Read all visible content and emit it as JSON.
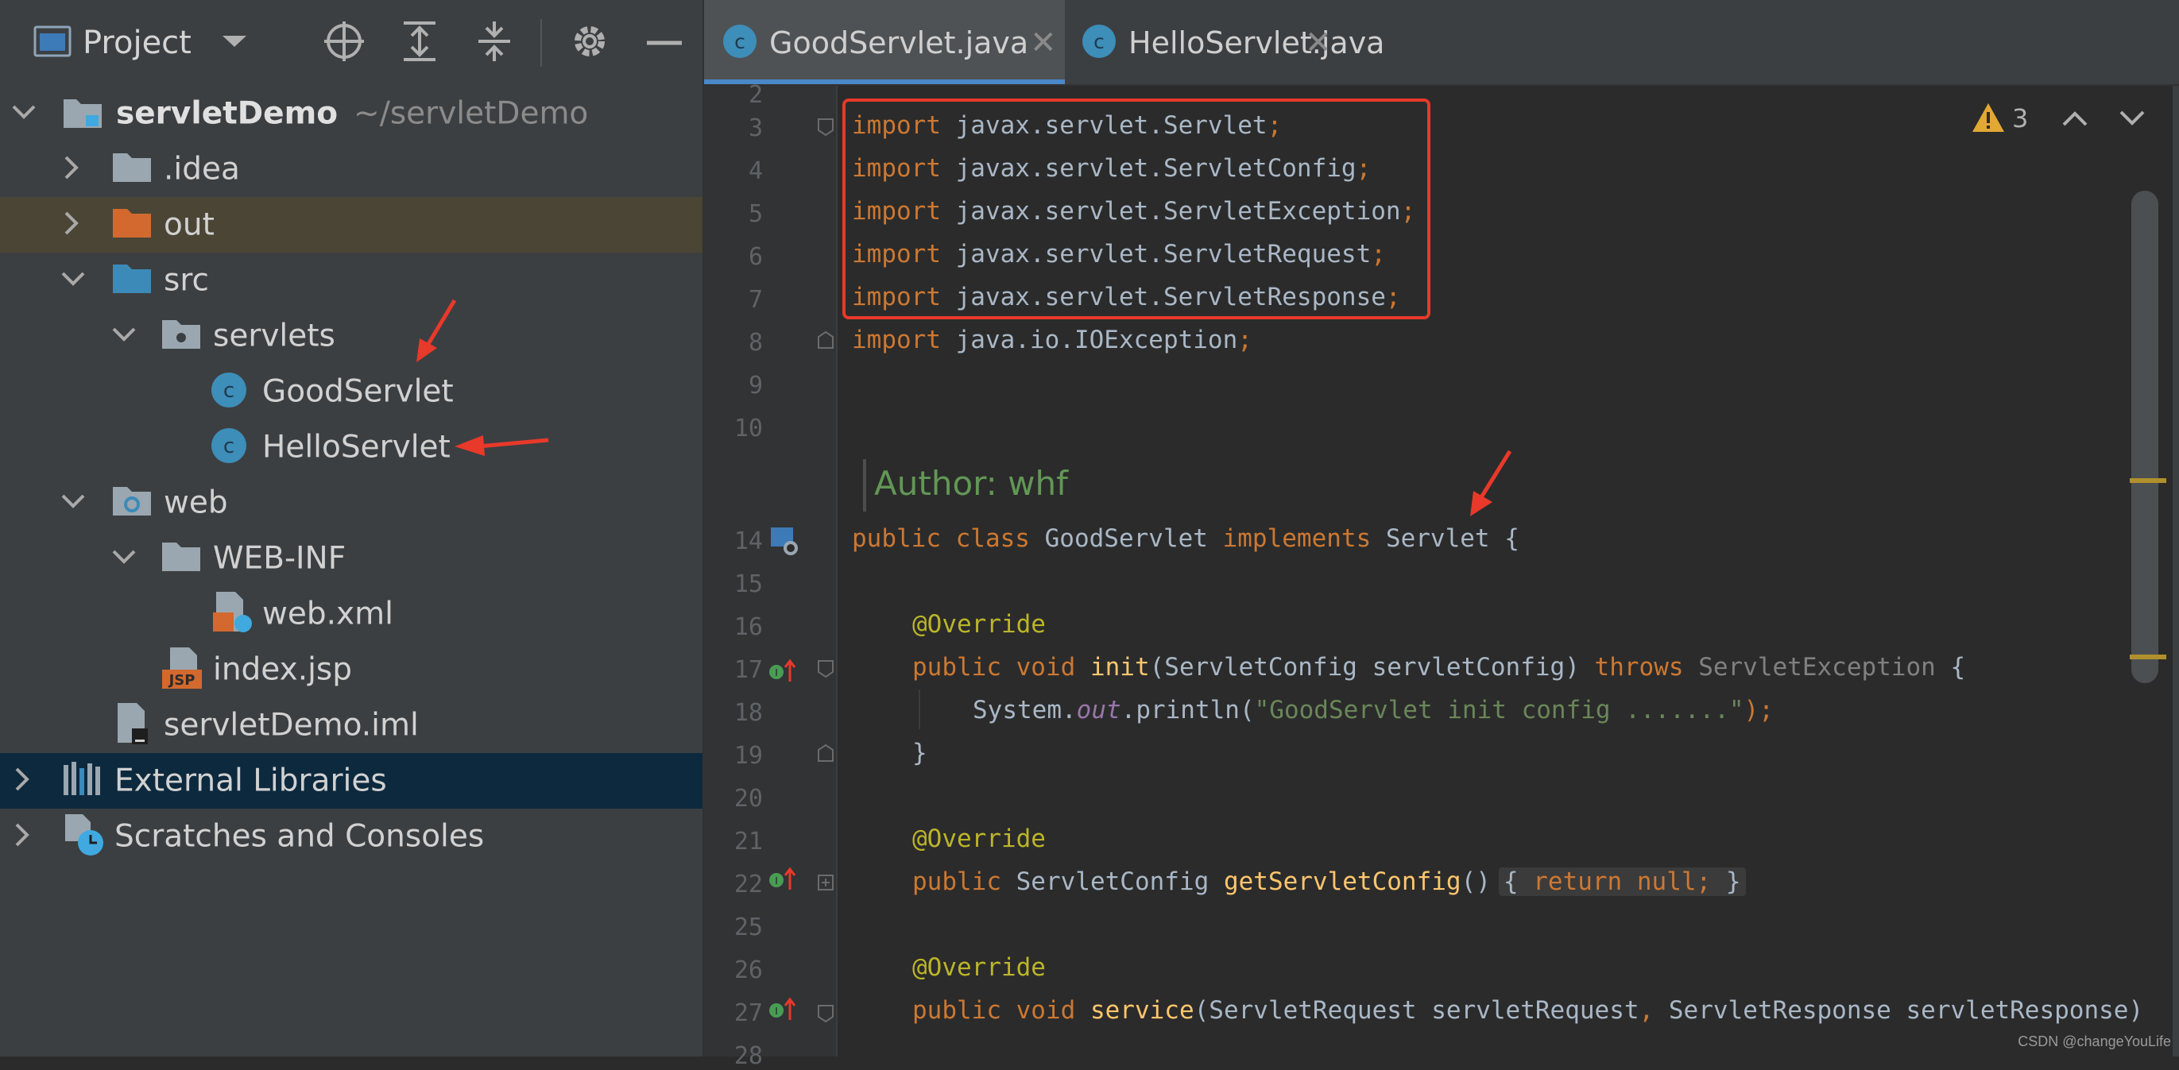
{
  "project_panel": {
    "title": "Project",
    "tree": [
      {
        "label": "servletDemo",
        "hint": "~/servletDemo"
      },
      {
        "label": ".idea"
      },
      {
        "label": "out"
      },
      {
        "label": "src"
      },
      {
        "label": "servlets"
      },
      {
        "label": "GoodServlet"
      },
      {
        "label": "HelloServlet"
      },
      {
        "label": "web"
      },
      {
        "label": "WEB-INF"
      },
      {
        "label": "web.xml"
      },
      {
        "label": "index.jsp"
      },
      {
        "label": "servletDemo.iml"
      },
      {
        "label": "External Libraries"
      },
      {
        "label": "Scratches and Consoles"
      }
    ]
  },
  "editor": {
    "tabs": [
      {
        "label": "GoodServlet.java",
        "active": true
      },
      {
        "label": "HelloServlet.java",
        "active": false
      }
    ],
    "warning_count": "3",
    "line_numbers": [
      "2",
      "3",
      "4",
      "5",
      "6",
      "7",
      "8",
      "9",
      "10",
      "14",
      "15",
      "16",
      "17",
      "18",
      "19",
      "20",
      "21",
      "22",
      "25",
      "26",
      "27",
      "28"
    ],
    "code": {
      "l3": [
        "import",
        " javax.servlet.Servlet",
        ";"
      ],
      "l4": [
        "import",
        " javax.servlet.ServletConfig",
        ";"
      ],
      "l5": [
        "import",
        " javax.servlet.ServletException",
        ";"
      ],
      "l6": [
        "import",
        " javax.servlet.ServletRequest",
        ";"
      ],
      "l7": [
        "import",
        " javax.servlet.ServletResponse",
        ";"
      ],
      "l8": [
        "import",
        " java.io.IOException",
        ";"
      ],
      "doc": "Author: whf",
      "l14": [
        "public class",
        " GoodServlet ",
        "implements",
        " Servlet {"
      ],
      "l16": "@Override",
      "l17": [
        "public void ",
        "init",
        "(ServletConfig servletConfig) ",
        "throws",
        " ServletException",
        " {"
      ],
      "l18": [
        "System.",
        "out",
        ".println(",
        "\"GoodServlet init config .......\"",
        ");"
      ],
      "l19": "}",
      "l21": "@Override",
      "l22": [
        "public",
        " ServletConfig ",
        "getServletConfig",
        "()",
        "{",
        " return null;",
        " }"
      ],
      "l26": "@Override",
      "l27": [
        "public void ",
        "service",
        "(ServletRequest servletRequest",
        ",",
        " ServletResponse servletResponse)"
      ]
    }
  },
  "watermark": "CSDN @changeYouLife",
  "colors": {
    "annotation_red": "#e8392a",
    "keyword": "#cc7832",
    "string": "#6a8759",
    "function": "#ffc66d"
  }
}
